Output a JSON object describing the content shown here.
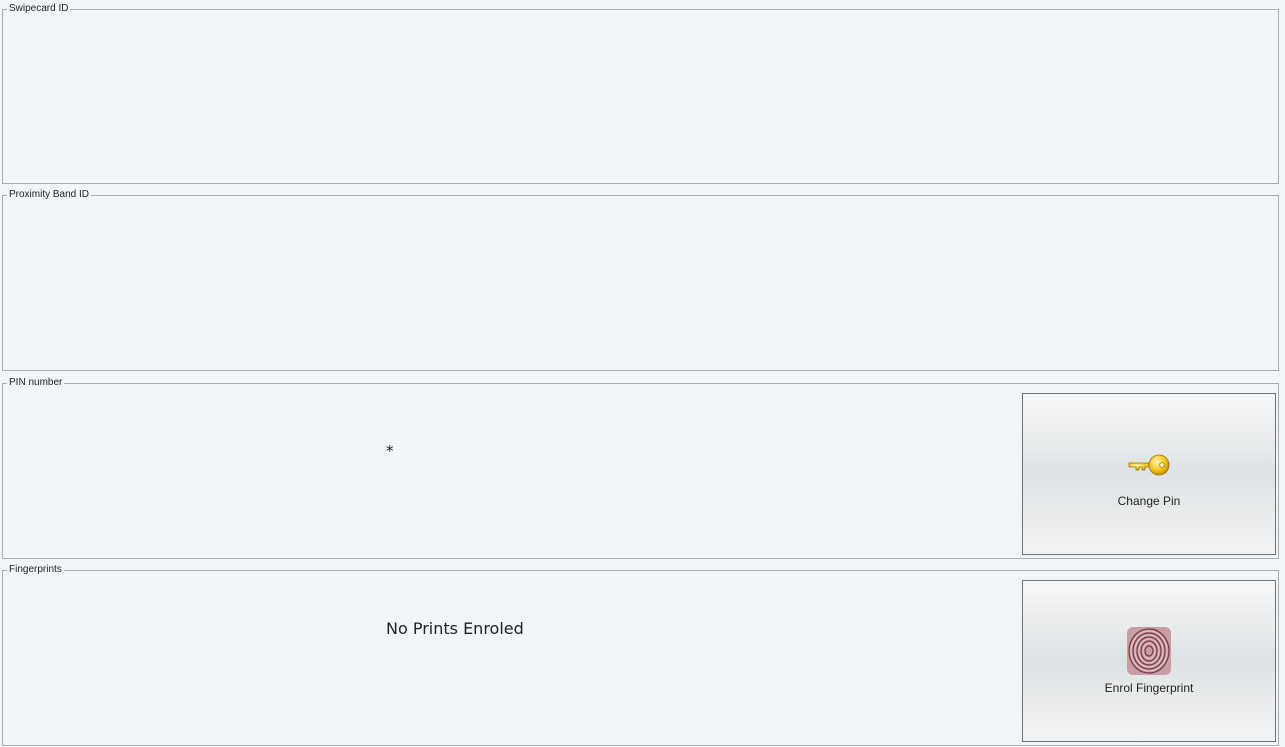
{
  "swipecard": {
    "title": "Swipecard ID"
  },
  "proximity": {
    "title": "Proximity Band ID"
  },
  "pin": {
    "title": "PIN number",
    "masked_value": "*",
    "change_button": {
      "label": "Change Pin",
      "icon": "key-icon"
    }
  },
  "fingerprints": {
    "title": "Fingerprints",
    "status": "No Prints Enroled",
    "enrol_button": {
      "label": "Enrol Fingerprint",
      "icon": "fingerprint-icon"
    }
  },
  "colors": {
    "background": "#f0f5f9",
    "border": "#a7adb3",
    "key_gold": "#f2c21a"
  }
}
